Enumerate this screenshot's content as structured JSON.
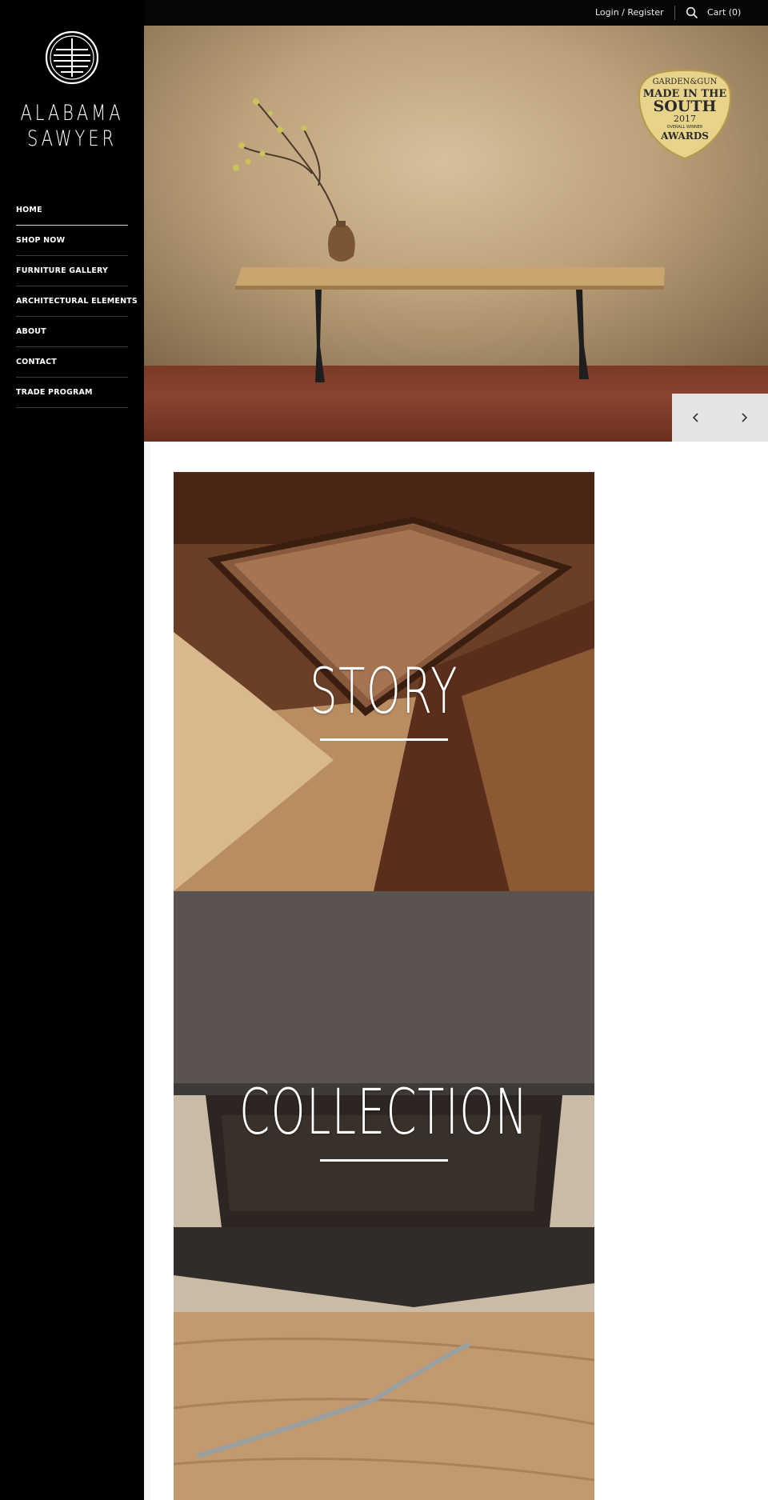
{
  "brand": {
    "name_line1": "ALABAMA",
    "name_line2": "SAWYER"
  },
  "topbar": {
    "login_label": "Login / Register",
    "search_icon": "search-icon",
    "cart_label": "Cart (0)"
  },
  "nav": {
    "items": [
      {
        "label": "HOME",
        "active": true
      },
      {
        "label": "SHOP NOW"
      },
      {
        "label": "FURNITURE GALLERY"
      },
      {
        "label": "ARCHITECTURAL ELEMENTS"
      },
      {
        "label": "ABOUT"
      },
      {
        "label": "CONTACT"
      },
      {
        "label": "TRADE PROGRAM"
      }
    ]
  },
  "hero": {
    "award": {
      "line1": "GARDEN&GUN",
      "line2": "MADE IN THE",
      "line3": "SOUTH",
      "line4": "2017",
      "line5": "OVERALL WINNER",
      "line6": "AWARDS"
    },
    "prev_icon": "chevron-left-icon",
    "next_icon": "chevron-right-icon"
  },
  "tiles": [
    {
      "title": "STORY"
    },
    {
      "title": "COLLECTION"
    },
    {
      "title": ""
    }
  ],
  "colors": {
    "sidebar": "#000000",
    "topbar": "#060606",
    "slider_bg": "#e4e4e4",
    "award_gold": "#e8d38a"
  }
}
